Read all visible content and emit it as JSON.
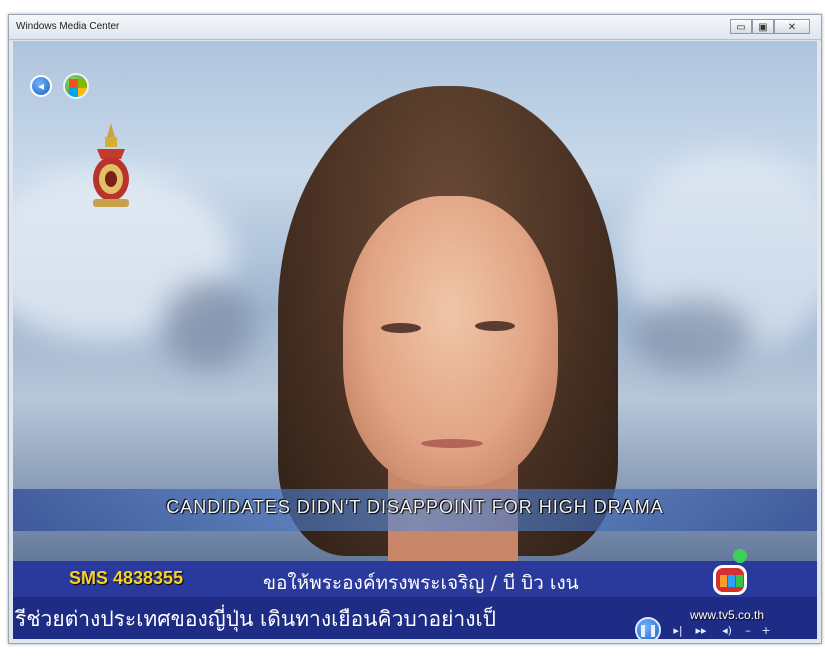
{
  "window": {
    "title": "Windows Media Center",
    "controls": {
      "minimize": "▭",
      "maximize": "▣",
      "close": "✕"
    }
  },
  "nav": {
    "back_icon": "back-arrow-icon",
    "start_icon": "windows-start-icon"
  },
  "broadcast": {
    "caption": "CANDIDATES DIDN'T DISAPPOINT FOR HIGH DRAMA",
    "sms": "SMS 4838355",
    "ticker_line1": "ขอให้พระองค์ทรงพระเจริญ / บี บิว เงน",
    "ticker_line2": "รีช่วยต่างประเทศของญี่ปุ่น เดินทางเยือนคิวบาอย่างเป็",
    "channel_url": "www.tv5.co.th"
  },
  "transport": {
    "pause": "❚❚",
    "skip_forward": "▸|",
    "fast_forward": "▸▸",
    "volume": "◂)",
    "vol_down": "–",
    "vol_up": "+"
  },
  "colors": {
    "ticker_bg": "#2a3a9c",
    "sms_text": "#f6d12a",
    "caption_text": "#f2f2f2",
    "accent": "#1c5fc4"
  }
}
